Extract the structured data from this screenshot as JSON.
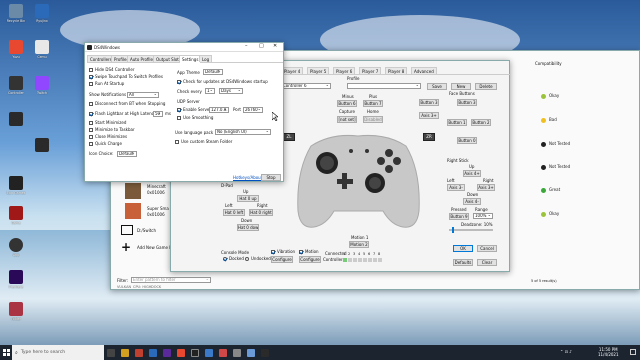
{
  "desktop": {
    "icons": [
      {
        "label": "Recycle Bin",
        "color": "#6a8aa8"
      },
      {
        "label": "Ryujinx",
        "color": "#2a6ab8"
      },
      {
        "label": "Yuzu",
        "color": "#e84830"
      },
      {
        "label": "Cemu",
        "color": "#e8e8e8"
      },
      {
        "label": "Twitch",
        "color": "#9146ff"
      },
      {
        "label": "Controller",
        "color": "#333"
      },
      {
        "label": "Epic Games",
        "color": "#222"
      },
      {
        "label": "Game",
        "color": "#a01818"
      },
      {
        "label": "App",
        "color": "#333"
      },
      {
        "label": "Premiere",
        "color": "#2a0a58"
      },
      {
        "label": "Folder",
        "color": "#aa3344"
      },
      {
        "label": "DS4Win",
        "color": "#333"
      }
    ]
  },
  "ds4": {
    "title": "DS4Windows",
    "tabs": [
      "Controllers",
      "Profiles",
      "Auto Profiles",
      "Output Slots",
      "Settings",
      "Log"
    ],
    "active_tab": "Settings",
    "checks": [
      {
        "label": "Hide DS4 Controller",
        "on": false
      },
      {
        "label": "Swipe Touchpad To Switch Profiles",
        "on": true
      },
      {
        "label": "Run At Startup",
        "on": false
      },
      {
        "label": "Disconnect from BT when Stopping",
        "on": false
      },
      {
        "label": "Flash Lightbar at High Latency",
        "on": true
      },
      {
        "label": "Start Minimized",
        "on": false
      },
      {
        "label": "Minimize to Taskbar",
        "on": false
      },
      {
        "label": "Close Minimizes",
        "on": false
      },
      {
        "label": "Quick Charge",
        "on": false
      }
    ],
    "show_notifications_label": "Show Notifications",
    "show_notifications_value": "All",
    "latency_value": "50",
    "latency_unit": "ms",
    "icon_choice_label": "Icon Choice:",
    "icon_choice_value": "Default",
    "app_theme_label": "App Theme",
    "app_theme_value": "Default",
    "check_updates_label": "Check for updates at DS4Windows startup",
    "check_every_label": "Check every",
    "check_every_value": "1",
    "check_every_unit": "Days",
    "udp_label": "UDP Server",
    "enable_server_label": "Enable Server",
    "server_ip": "127.0.0.1",
    "port_label": "Port",
    "port_value": "26760",
    "smoothing_label": "Use Smoothing",
    "language_label": "Use language pack",
    "language_value": "No (English UI)",
    "steam_folder_label": "Use custom Steam Folder",
    "hotkeys_link": "Hotkeys/About",
    "stop_button": "Stop"
  },
  "mapper": {
    "tabs": [
      "Player 4",
      "Player 5",
      "Player 6",
      "Player 7",
      "Player 8",
      "Advanced"
    ],
    "profile_label": "Profile",
    "controller_value": "Controller 6",
    "save": "Save",
    "new": "New",
    "delete": "Delete",
    "plus_label": "Plus",
    "minus_label": "Minus",
    "button6": "Button 6",
    "button7": "Button 7",
    "capture_label": "Capture",
    "home_label": "Home",
    "not_set": "[not set]",
    "disabled": "Disabled",
    "face_label": "Face Buttons",
    "button3": "Button 3",
    "button1": "Button 1",
    "button2": "Button 2",
    "button0": "Button 0",
    "axis_label": "Axis 3+",
    "zl": "ZL",
    "zr": "ZR",
    "dpad_label": "D-Pad",
    "up": "Up",
    "hat0up": "Hat 0 up",
    "left": "Left",
    "right": "Right",
    "hat0left": "Hat 0 left",
    "hat0right": "Hat 0 right",
    "down": "Down",
    "hat0down": "Hat 0 down",
    "right_stick": "Right Stick",
    "axis4p": "Axis 4+",
    "axis3m": "Axis 3-",
    "axis3p": "Axis 3+",
    "axis4m": "Axis 4-",
    "pressed": "Pressed",
    "range": "Range",
    "button9": "Button 9",
    "range_val": "100%",
    "deadzone": "Deadzone: 10%",
    "motion_label": "Motion 1",
    "motion_val": "Motion 2",
    "console_mode": "Console Mode",
    "docked": "Docked",
    "undocked": "Undocked",
    "vibration": "Vibration",
    "motion": "Motion",
    "configure": "Configure",
    "connected": "Connected",
    "controller_nums": [
      "1",
      "2",
      "3",
      "4",
      "5",
      "6",
      "7",
      "8"
    ],
    "controllers_label": "Controllers",
    "defaults": "Defaults",
    "clear": "Clear",
    "ok": "OK",
    "cancel": "Cancel"
  },
  "games": {
    "compat_header": "Compatibility",
    "statuses": [
      {
        "label": "Okay",
        "color": "#9bc43a"
      },
      {
        "label": "Bad",
        "color": "#f0c020"
      },
      {
        "label": "Not Tested",
        "color": "#222"
      },
      {
        "label": "Not Tested",
        "color": "#222"
      },
      {
        "label": "Great",
        "color": "#3aa838"
      },
      {
        "label": "Okay",
        "color": "#9bc43a"
      }
    ],
    "game1": "Minecraft",
    "game1_id": "0x01006",
    "game2": "Super Sma",
    "game2_id": "0x01006",
    "dir_label": "D:/Switch",
    "add_label": "Add New Game Dir",
    "filter_label": "Filter:",
    "filter_placeholder": "Enter pattern to filter",
    "status_vulkan": "VULKAN",
    "status_cpu": "CPU: HIGH",
    "status_dock": "DOCK",
    "result_count": "5 of 5 result(s)"
  },
  "taskbar": {
    "search_placeholder": "Type here to search",
    "time": "11:50 PM",
    "date": "11/4/2021"
  }
}
